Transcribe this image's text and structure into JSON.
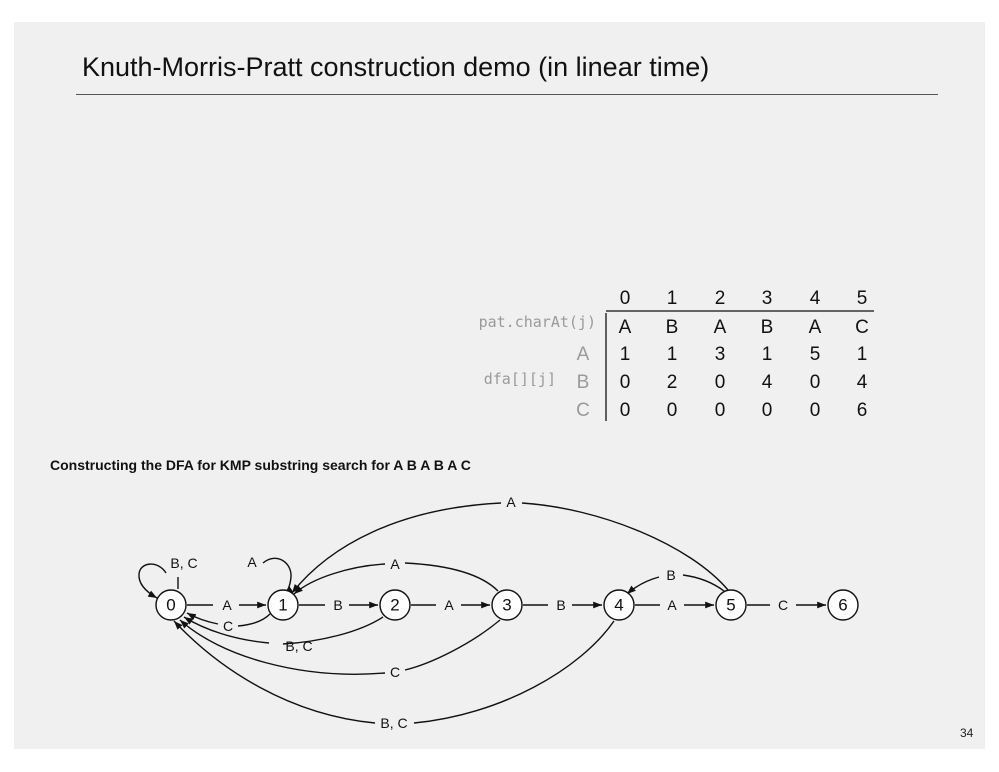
{
  "title": "Knuth-Morris-Pratt construction demo (in linear time)",
  "caption": "Constructing the DFA for KMP substring search for  A B A B A C",
  "page_number": "34",
  "table": {
    "columns": [
      "0",
      "1",
      "2",
      "3",
      "4",
      "5"
    ],
    "pat_label": "pat.charAt(j)",
    "pattern": [
      "A",
      "B",
      "A",
      "B",
      "A",
      "C"
    ],
    "dfa_label": "dfa[][j]",
    "rows": [
      {
        "char": "A",
        "values": [
          "1",
          "1",
          "3",
          "1",
          "5",
          "1"
        ]
      },
      {
        "char": "B",
        "values": [
          "0",
          "2",
          "0",
          "4",
          "0",
          "4"
        ]
      },
      {
        "char": "C",
        "values": [
          "0",
          "0",
          "0",
          "0",
          "0",
          "6"
        ]
      }
    ]
  },
  "dfa": {
    "states": [
      "0",
      "1",
      "2",
      "3",
      "4",
      "5",
      "6"
    ],
    "transitions": [
      {
        "from": "0",
        "to": "0",
        "label": "B, C"
      },
      {
        "from": "0",
        "to": "1",
        "label": "A"
      },
      {
        "from": "1",
        "to": "1",
        "label": "A"
      },
      {
        "from": "1",
        "to": "0",
        "label": "C"
      },
      {
        "from": "1",
        "to": "2",
        "label": "B"
      },
      {
        "from": "2",
        "to": "0",
        "label": "B, C"
      },
      {
        "from": "2",
        "to": "3",
        "label": "A"
      },
      {
        "from": "3",
        "to": "1",
        "label": "A"
      },
      {
        "from": "3",
        "to": "0",
        "label": "C"
      },
      {
        "from": "3",
        "to": "4",
        "label": "B"
      },
      {
        "from": "4",
        "to": "0",
        "label": "B, C"
      },
      {
        "from": "4",
        "to": "5",
        "label": "A"
      },
      {
        "from": "5",
        "to": "1",
        "label": "A"
      },
      {
        "from": "5",
        "to": "4",
        "label": "B"
      },
      {
        "from": "5",
        "to": "6",
        "label": "C"
      }
    ]
  },
  "colors": {
    "background": "#f0f0f0",
    "text": "#111111",
    "muted_label": "#9a9a9a",
    "line": "#111111"
  }
}
